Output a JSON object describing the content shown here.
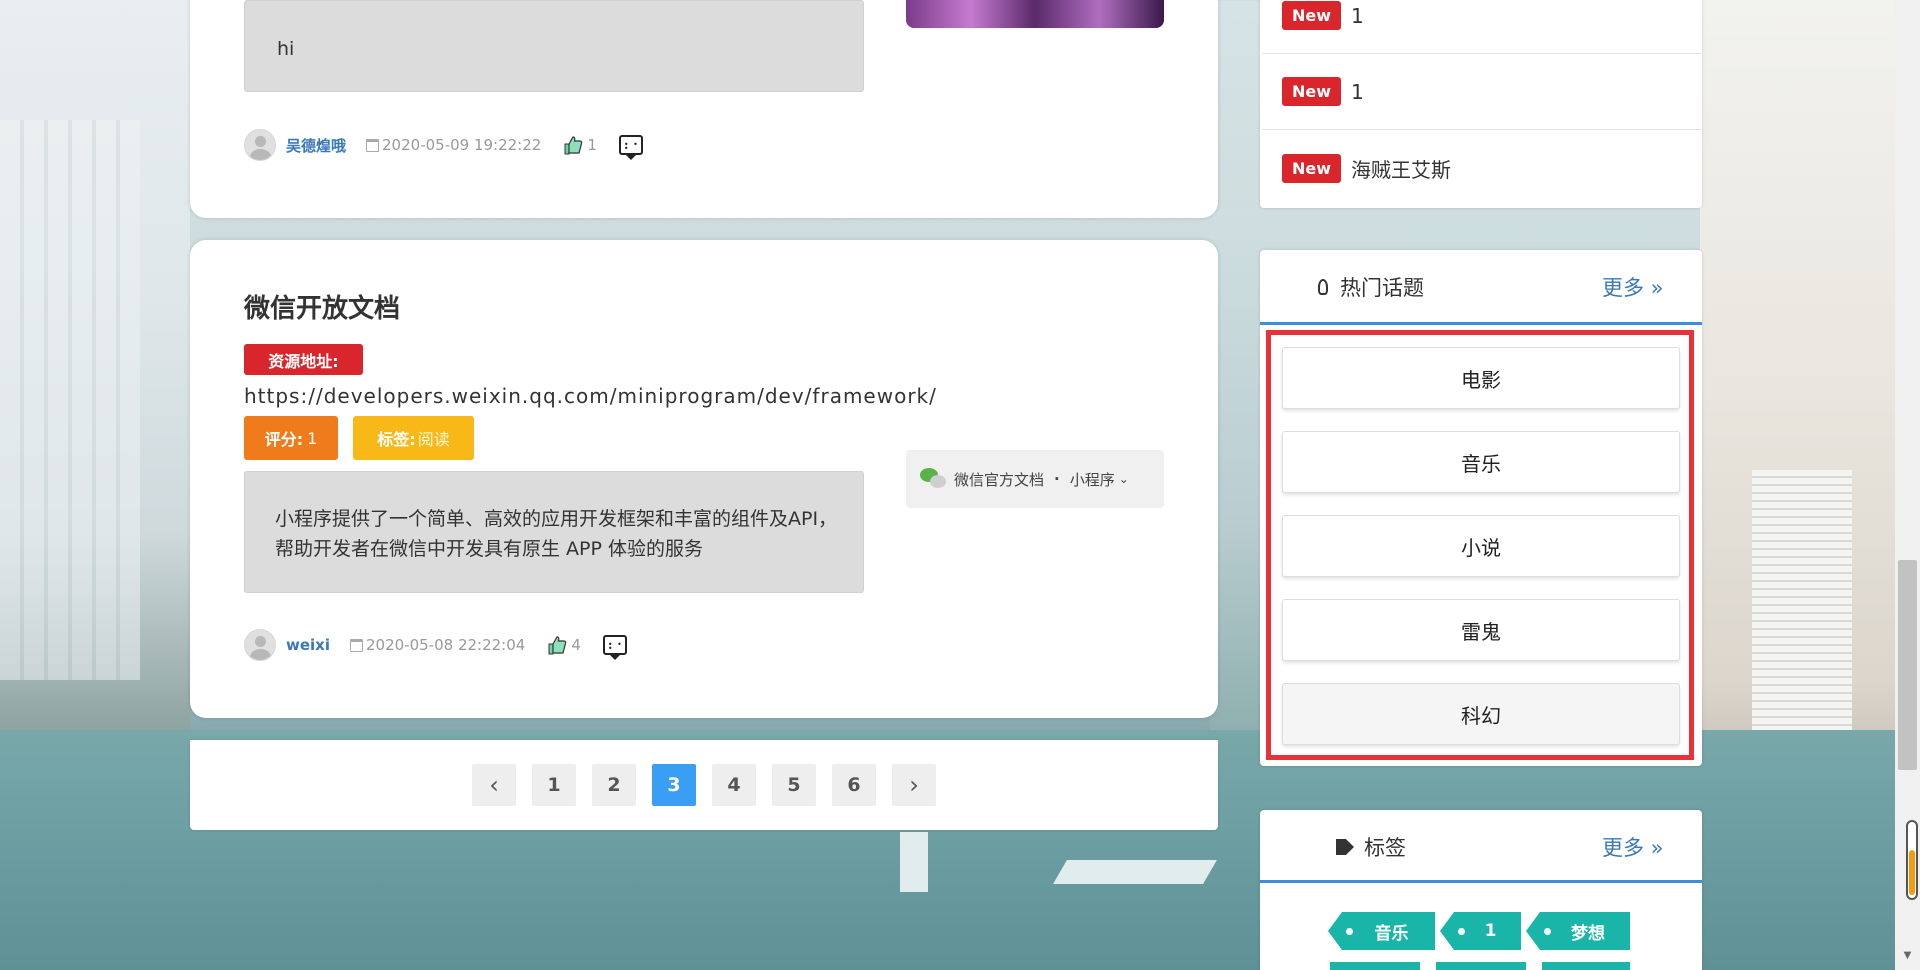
{
  "posts": [
    {
      "content": "hi",
      "author": "吴德煌哦",
      "date": "2020-05-09 19:22:22",
      "likes": "1"
    },
    {
      "title": "微信开放文档",
      "resource_label": "资源地址:",
      "resource_url": "https://developers.weixin.qq.com/miniprogram/dev/framework/",
      "score_label": "评分:",
      "score": "1",
      "tag_label": "标签:",
      "tag": "阅读",
      "content": "小程序提供了一个简单、高效的应用开发框架和丰富的组件及API，帮助开发者在微信中开发具有原生 APP 体验的服务",
      "preview_site": "微信官方文档",
      "preview_dot": "·",
      "preview_section": "小程序",
      "author": "weixi",
      "date": "2020-05-08 22:22:04",
      "likes": "4"
    }
  ],
  "pagination": {
    "prev": "‹",
    "pages": [
      "1",
      "2",
      "3",
      "4",
      "5",
      "6"
    ],
    "current": "3",
    "next": "›"
  },
  "sidebar": {
    "new_items": [
      {
        "badge": "New",
        "text": "1"
      },
      {
        "badge": "New",
        "text": "1"
      },
      {
        "badge": "New",
        "text": "海贼王艾斯"
      }
    ],
    "hot_topics": {
      "title": "热门话题",
      "more": "更多 »",
      "items": [
        "电影",
        "音乐",
        "小说",
        "雷鬼",
        "科幻"
      ]
    },
    "tags": {
      "title": "标签",
      "more": "更多 »",
      "items": [
        "音乐",
        "1",
        "梦想"
      ]
    }
  },
  "colors": {
    "accent_blue": "#3b9ef5",
    "new_red": "#d9262c",
    "score_orange": "#f07b1a",
    "tag_yellow": "#f7b818",
    "tag_teal": "#19b5a8",
    "highlight_red": "#e8323a"
  }
}
